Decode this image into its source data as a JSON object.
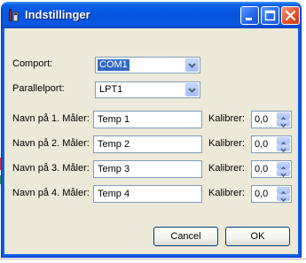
{
  "window": {
    "title": "Indstillinger"
  },
  "titlebar_buttons": {
    "minimize": "minimize-icon",
    "maximize": "maximize-icon",
    "close": "close-icon"
  },
  "ports": {
    "comport_label": "Comport:",
    "comport_value": "COM1",
    "parallelport_label": "Parallelport:",
    "parallelport_value": "LPT1"
  },
  "meters": [
    {
      "label": "Navn på 1. Måler:",
      "name": "Temp 1",
      "calib_label": "Kalibrer:",
      "calib_value": "0,0"
    },
    {
      "label": "Navn på 2. Måler:",
      "name": "Temp 2",
      "calib_label": "Kalibrer:",
      "calib_value": "0,0"
    },
    {
      "label": "Navn på 3. Måler:",
      "name": "Temp 3",
      "calib_label": "Kalibrer:",
      "calib_value": "0,0"
    },
    {
      "label": "Navn på 4. Måler:",
      "name": "Temp 4",
      "calib_label": "Kalibrer:",
      "calib_value": "0,0"
    }
  ],
  "buttons": {
    "cancel": "Cancel",
    "ok": "OK"
  },
  "colors": {
    "titlebar": "#0a5fe6",
    "dialog_bg": "#ece9d8",
    "selection": "#316ac5",
    "close_button": "#e2532b"
  }
}
